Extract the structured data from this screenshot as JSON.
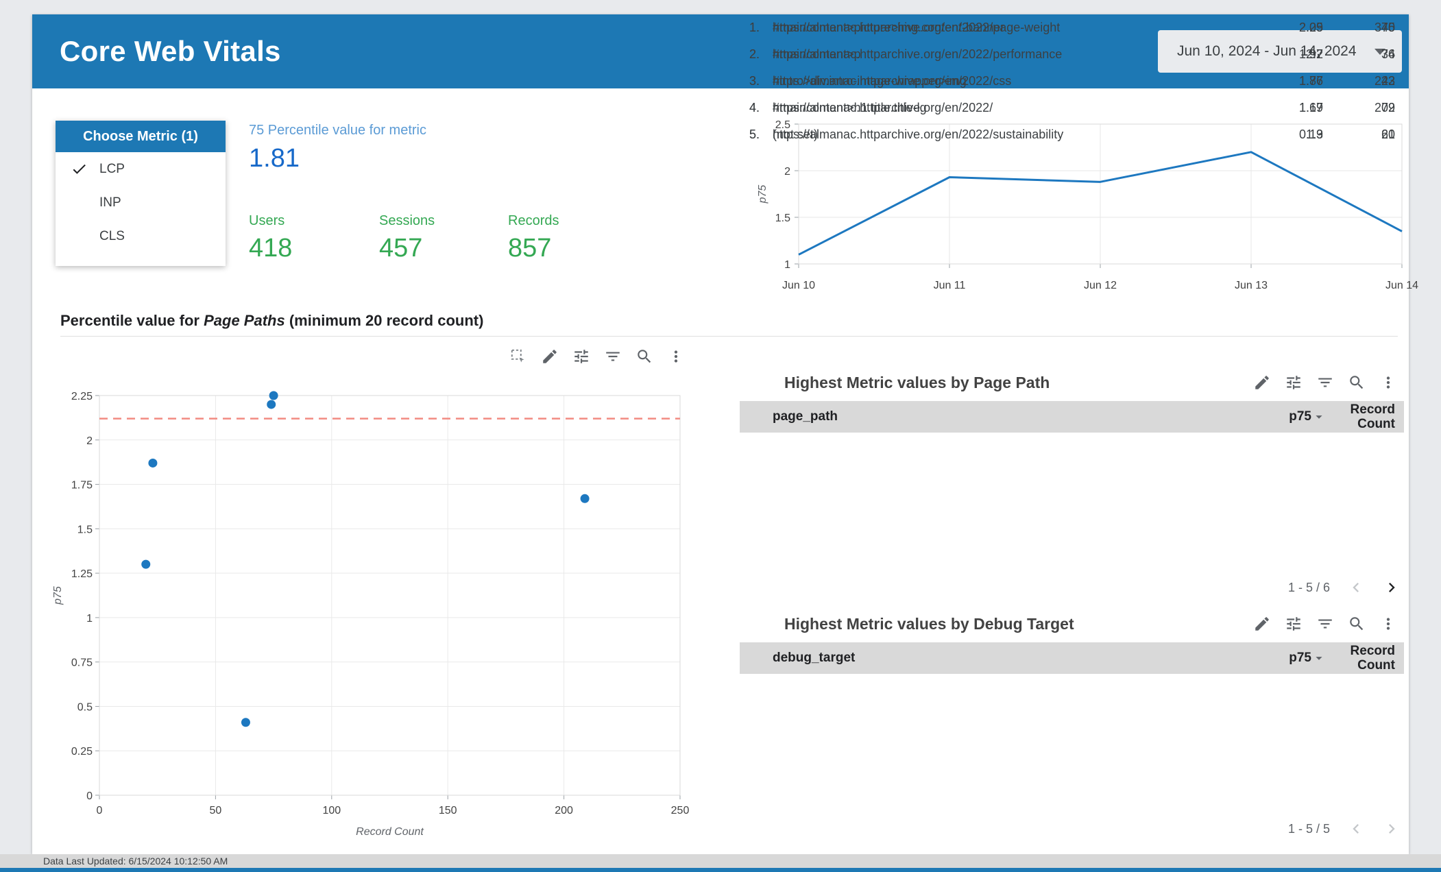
{
  "header": {
    "title": "Core Web Vitals",
    "date_range": "Jun 10, 2024 - Jun 14, 2024"
  },
  "metric_selector": {
    "title": "Choose Metric (1)",
    "options": [
      {
        "label": "LCP",
        "selected": true
      },
      {
        "label": "INP",
        "selected": false
      },
      {
        "label": "CLS",
        "selected": false
      }
    ]
  },
  "scorecards": {
    "percentile_label": "75 Percentile value for metric",
    "percentile_value": "1.81",
    "users_label": "Users",
    "users_value": "418",
    "sessions_label": "Sessions",
    "sessions_value": "457",
    "records_label": "Records",
    "records_value": "857"
  },
  "section": {
    "title_prefix": "Percentile value for ",
    "title_italic": "Page Paths",
    "title_suffix": " (minimum 20 record count)"
  },
  "tables": [
    {
      "title": "Highest Metric values by Page Path",
      "columns": [
        "page_path",
        "p75",
        "Record Count"
      ],
      "rows": [
        [
          "1.",
          "https://almanac.httparchive.org/en/2022/page-weight",
          "2.25",
          "75"
        ],
        [
          "2.",
          "https://almanac.httparchive.org/en/2022/performance",
          "2.2",
          "74"
        ],
        [
          "3.",
          "https://almanac.httparchive.org/en/2022/css",
          "1.87",
          "23"
        ],
        [
          "4.",
          "https://almanac.httparchive.org/en/2022/",
          "1.67",
          "209"
        ],
        [
          "5.",
          "https://almanac.httparchive.org/en/2022/sustainability",
          "1.3",
          "20"
        ]
      ],
      "pagination": "1 - 5 / 6",
      "prev_enabled": false,
      "next_enabled": true
    },
    {
      "title": "Highest Metric values by Debug Target",
      "columns": [
        "debug_target",
        "p75",
        "Record Count"
      ],
      "rows": [
        [
          "1.",
          "#maincontent>picture>img.content-banner",
          "2.09",
          "340"
        ],
        [
          "2.",
          "#maincontent>p",
          "1.97",
          "36"
        ],
        [
          "3.",
          "#intro>div.intro-image-wrapper>img",
          "1.76",
          "242"
        ],
        [
          "4.",
          "#maincontent>h1.title.title-lg",
          "1.19",
          "72"
        ],
        [
          "5.",
          "(not set)",
          "0.19",
          "61"
        ]
      ],
      "pagination": "1 - 5 / 5",
      "prev_enabled": false,
      "next_enabled": false
    }
  ],
  "footer": {
    "text": "Data Last Updated: 6/15/2024 10:12:50 AM"
  },
  "chart_data": [
    {
      "type": "line",
      "x": [
        "Jun 10",
        "Jun 11",
        "Jun 12",
        "Jun 13",
        "Jun 14"
      ],
      "values": [
        1.1,
        1.93,
        1.88,
        2.2,
        1.35
      ],
      "ylabel": "p75",
      "ylim": [
        1,
        2.5
      ],
      "yticks": [
        1,
        1.5,
        2,
        2.5
      ],
      "grid": true,
      "legend": "none",
      "line_color": "#1d78c0"
    },
    {
      "type": "scatter",
      "title": "Percentile value for Page Paths (minimum 20 record count)",
      "points": [
        [
          20,
          1.3
        ],
        [
          23,
          1.87
        ],
        [
          63,
          0.41
        ],
        [
          74,
          2.2
        ],
        [
          75,
          2.25
        ],
        [
          209,
          1.67
        ]
      ],
      "xlabel": "Record Count",
      "ylabel": "p75",
      "xlim": [
        0,
        250
      ],
      "ylim": [
        0,
        2.25
      ],
      "xticks": [
        0,
        50,
        100,
        150,
        200,
        250
      ],
      "yticks": [
        0,
        0.25,
        0.5,
        0.75,
        1,
        1.25,
        1.5,
        1.75,
        2,
        2.25
      ],
      "grid": true,
      "point_color": "#1d78c0",
      "reference_line": {
        "y": 2.12,
        "color": "#f28b82",
        "style": "dashed"
      }
    }
  ],
  "colors": {
    "header_blue": "#1d78b4",
    "metric_label_blue": "#5b9bd5",
    "metric_value_blue": "#1769c9",
    "kpi_green": "#34a853",
    "table_header_bg": "#d9d9d9",
    "chart_accent": "#1d78c0",
    "reference_red": "#f28b82"
  }
}
